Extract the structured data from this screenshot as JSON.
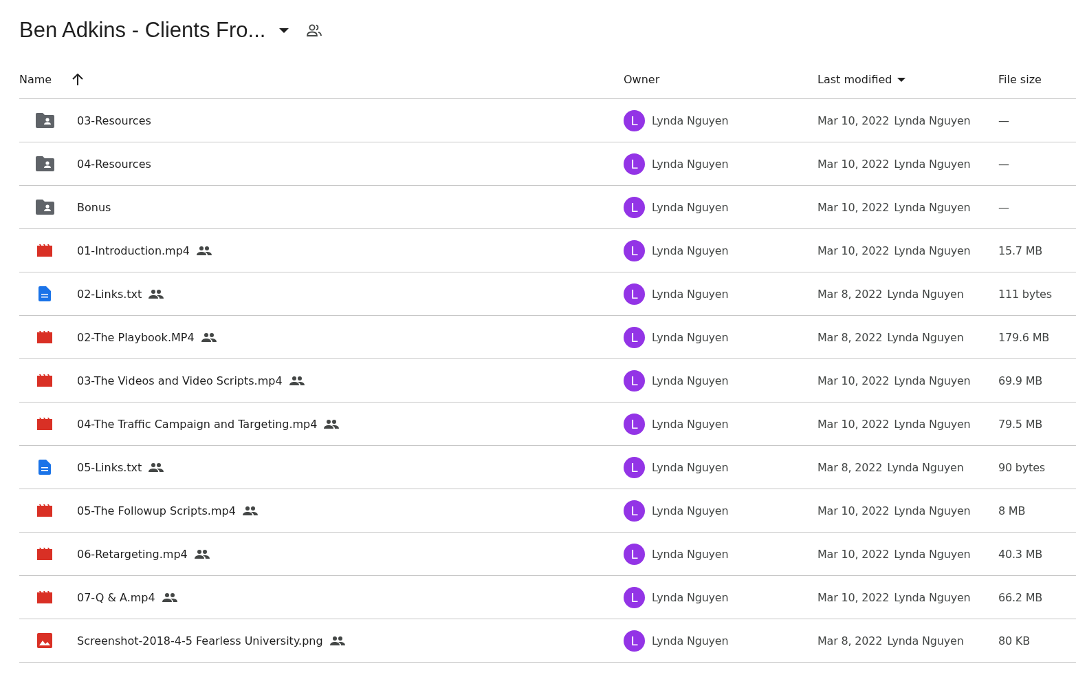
{
  "title": "Ben Adkins - Clients Fro...",
  "columns": [
    {
      "label": "Name",
      "kind": "sort"
    },
    {
      "label": "Owner",
      "kind": "plain"
    },
    {
      "label": "Last modified",
      "kind": "menu"
    },
    {
      "label": "File size",
      "kind": "plain"
    }
  ],
  "rows": [
    {
      "name": "03-Resources",
      "kind": "folder",
      "shared": false,
      "owner": {
        "initial": "L",
        "name": "Lynda Nguyen",
        "color": "#9334e6"
      },
      "date": "Mar 10, 2022",
      "modified_by": "Lynda Nguyen",
      "size": "—"
    },
    {
      "name": "04-Resources",
      "kind": "folder",
      "shared": false,
      "owner": {
        "initial": "L",
        "name": "Lynda Nguyen",
        "color": "#9334e6"
      },
      "date": "Mar 10, 2022",
      "modified_by": "Lynda Nguyen",
      "size": "—"
    },
    {
      "name": "Bonus",
      "kind": "folder",
      "shared": false,
      "owner": {
        "initial": "L",
        "name": "Lynda Nguyen",
        "color": "#9334e6"
      },
      "date": "Mar 10, 2022",
      "modified_by": "Lynda Nguyen",
      "size": "—"
    },
    {
      "name": "01-Introduction.mp4",
      "kind": "video",
      "shared": true,
      "owner": {
        "initial": "L",
        "name": "Lynda Nguyen",
        "color": "#9334e6"
      },
      "date": "Mar 10, 2022",
      "modified_by": "Lynda Nguyen",
      "size": "15.7 MB"
    },
    {
      "name": "02-Links.txt",
      "kind": "doc",
      "shared": true,
      "owner": {
        "initial": "L",
        "name": "Lynda Nguyen",
        "color": "#9334e6"
      },
      "date": "Mar 8, 2022",
      "modified_by": "Lynda Nguyen",
      "size": "111 bytes"
    },
    {
      "name": "02-The Playbook.MP4",
      "kind": "video",
      "shared": true,
      "owner": {
        "initial": "L",
        "name": "Lynda Nguyen",
        "color": "#9334e6"
      },
      "date": "Mar 8, 2022",
      "modified_by": "Lynda Nguyen",
      "size": "179.6 MB"
    },
    {
      "name": "03-The Videos and Video Scripts.mp4",
      "kind": "video",
      "shared": true,
      "owner": {
        "initial": "L",
        "name": "Lynda Nguyen",
        "color": "#9334e6"
      },
      "date": "Mar 10, 2022",
      "modified_by": "Lynda Nguyen",
      "size": "69.9 MB"
    },
    {
      "name": "04-The Traffic Campaign and Targeting.mp4",
      "kind": "video",
      "shared": true,
      "owner": {
        "initial": "L",
        "name": "Lynda Nguyen",
        "color": "#9334e6"
      },
      "date": "Mar 10, 2022",
      "modified_by": "Lynda Nguyen",
      "size": "79.5 MB"
    },
    {
      "name": "05-Links.txt",
      "kind": "doc",
      "shared": true,
      "owner": {
        "initial": "L",
        "name": "Lynda Nguyen",
        "color": "#9334e6"
      },
      "date": "Mar 8, 2022",
      "modified_by": "Lynda Nguyen",
      "size": "90 bytes"
    },
    {
      "name": "05-The Followup Scripts.mp4",
      "kind": "video",
      "shared": true,
      "owner": {
        "initial": "L",
        "name": "Lynda Nguyen",
        "color": "#9334e6"
      },
      "date": "Mar 10, 2022",
      "modified_by": "Lynda Nguyen",
      "size": "8 MB"
    },
    {
      "name": "06-Retargeting.mp4",
      "kind": "video",
      "shared": true,
      "owner": {
        "initial": "L",
        "name": "Lynda Nguyen",
        "color": "#9334e6"
      },
      "date": "Mar 10, 2022",
      "modified_by": "Lynda Nguyen",
      "size": "40.3 MB"
    },
    {
      "name": "07-Q & A.mp4",
      "kind": "video",
      "shared": true,
      "owner": {
        "initial": "L",
        "name": "Lynda Nguyen",
        "color": "#9334e6"
      },
      "date": "Mar 10, 2022",
      "modified_by": "Lynda Nguyen",
      "size": "66.2 MB"
    },
    {
      "name": "Screenshot-2018-4-5 Fearless University.png",
      "kind": "image",
      "shared": true,
      "owner": {
        "initial": "L",
        "name": "Lynda Nguyen",
        "color": "#9334e6"
      },
      "date": "Mar 8, 2022",
      "modified_by": "Lynda Nguyen",
      "size": "80 KB"
    }
  ]
}
